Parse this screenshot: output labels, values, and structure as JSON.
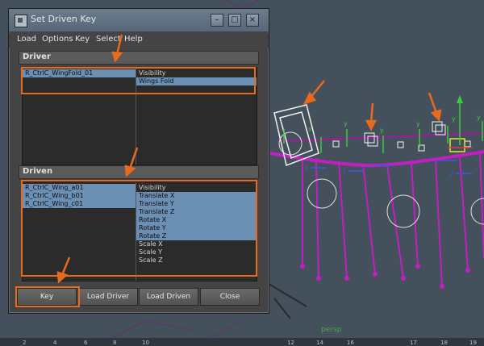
{
  "dialog": {
    "title": "Set Driven Key",
    "menu": [
      "Load",
      "Options",
      "Key",
      "Select",
      "Help"
    ],
    "driver": {
      "label": "Driver",
      "objects": [
        {
          "text": "R_CtrlC_WingFold_01",
          "selected": true
        }
      ],
      "attributes": [
        {
          "text": "Visibility",
          "selected": false
        },
        {
          "text": "Wings Fold",
          "selected": true
        }
      ]
    },
    "driven": {
      "label": "Driven",
      "objects": [
        {
          "text": "R_CtrlC_Wing_a01",
          "selected": true
        },
        {
          "text": "R_CtrlC_Wing_b01",
          "selected": true
        },
        {
          "text": "R_CtrlC_Wing_c01",
          "selected": true
        }
      ],
      "attributes": [
        {
          "text": "Visibility",
          "selected": false
        },
        {
          "text": "Translate X",
          "selected": true
        },
        {
          "text": "Translate Y",
          "selected": true
        },
        {
          "text": "Translate Z",
          "selected": true
        },
        {
          "text": "Rotate X",
          "selected": true
        },
        {
          "text": "Rotate Y",
          "selected": true
        },
        {
          "text": "Rotate Z",
          "selected": true
        },
        {
          "text": "Scale X",
          "selected": false
        },
        {
          "text": "Scale Y",
          "selected": false
        },
        {
          "text": "Scale Z",
          "selected": false
        }
      ]
    },
    "buttons": {
      "key": "Key",
      "load_driver": "Load Driver",
      "load_driven": "Load Driven",
      "close": "Close"
    }
  },
  "viewport": {
    "camera_label": "persp",
    "ruler_labels": [
      "2",
      "4",
      "6",
      "8",
      "10",
      "12",
      "14",
      "16",
      "17",
      "18",
      "19"
    ],
    "colors": {
      "background": "#44505b",
      "joints": "#c21fc2",
      "controls": "#ffffff",
      "axis_y": "#3ccd3c",
      "axis_z": "#3a5ad8",
      "annotation": "#e86a1c"
    }
  },
  "colors": {
    "dialog_bg": "#444444",
    "list_bg": "#2b2b2b",
    "selection": "#6c8fb4",
    "highlight": "#e86a1c"
  }
}
